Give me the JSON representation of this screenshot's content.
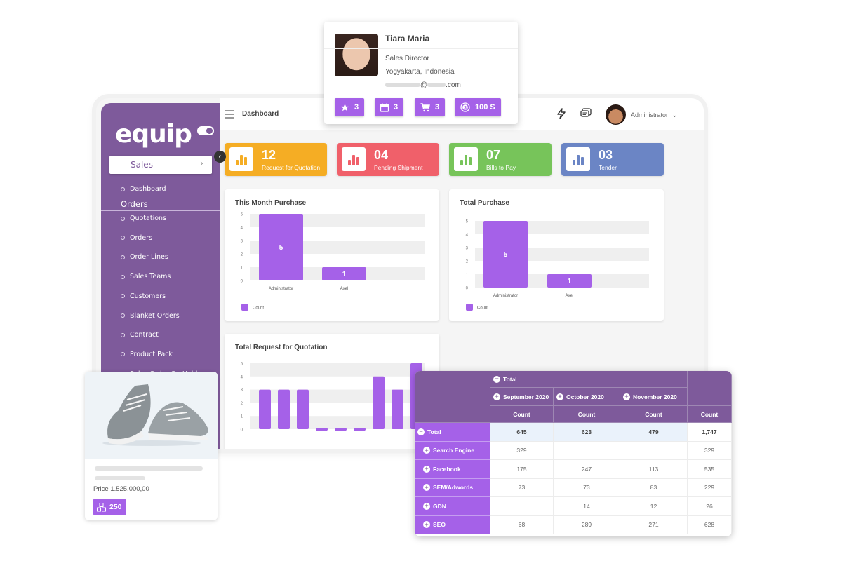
{
  "app": {
    "logo": "equip",
    "sidebar": {
      "active_module": "Sales",
      "items_top": [
        {
          "label": "Dashboard"
        }
      ],
      "section": "Orders",
      "items": [
        {
          "label": "Quotations"
        },
        {
          "label": "Orders"
        },
        {
          "label": "Order Lines"
        },
        {
          "label": "Sales Teams"
        },
        {
          "label": "Customers"
        },
        {
          "label": "Blanket Orders"
        },
        {
          "label": "Contract"
        },
        {
          "label": "Product Pack"
        },
        {
          "label": "Sales Order  On Hold"
        }
      ]
    },
    "topbar": {
      "title": "Dashboard",
      "icons": [
        "lightning-icon",
        "chat-icon"
      ],
      "user": "Administrator",
      "user_chevron": "⌄"
    },
    "stats": [
      {
        "value": "12",
        "label": "Request for Quotation",
        "color": "#f5ad24"
      },
      {
        "value": "04",
        "label": "Pending Shipment",
        "color": "#f0606a"
      },
      {
        "value": "07",
        "label": "Bills to Pay",
        "color": "#77c45a"
      },
      {
        "value": "03",
        "label": "Tender",
        "color": "#6b85c5"
      }
    ]
  },
  "profile": {
    "name": "Tiara Maria",
    "title": "Sales Director",
    "location": "Yogyakarta, Indonesia",
    "email_at": "@",
    "email_domain_suffix": ".com",
    "badges": [
      {
        "icon": "star-icon",
        "glyph": "★",
        "value": "3"
      },
      {
        "icon": "calendar-icon",
        "glyph": "▦",
        "value": "3"
      },
      {
        "icon": "cart-icon",
        "glyph": "🛒",
        "value": "3"
      },
      {
        "icon": "coin-icon",
        "glyph": "$",
        "value": "100 S"
      }
    ]
  },
  "product": {
    "price_label": "Price 1.525.000,00",
    "stock": "250"
  },
  "chart_data": [
    {
      "type": "bar",
      "title": "This Month Purchase",
      "categories": [
        "Administrator",
        "Axel"
      ],
      "values": [
        5,
        1
      ],
      "legend": [
        "Count"
      ],
      "legend_position": "bottom-left",
      "ylim": [
        0,
        5
      ],
      "yticks": [
        0,
        1,
        2,
        3,
        4,
        5
      ],
      "color": "#a561e8"
    },
    {
      "type": "bar",
      "title": "Total Purchase",
      "categories": [
        "Administrator",
        "Axel"
      ],
      "values": [
        5,
        1
      ],
      "legend": [
        "Count"
      ],
      "legend_position": "bottom-left",
      "ylim": [
        0,
        5
      ],
      "yticks": [
        0,
        1,
        2,
        3,
        4,
        5
      ],
      "color": "#a561e8"
    },
    {
      "type": "bar",
      "title": "Total Request for Quotation",
      "categories": [
        "",
        "",
        "",
        "",
        "",
        "",
        "",
        "",
        ""
      ],
      "values": [
        3,
        3,
        3,
        0.1,
        0.1,
        0.1,
        4,
        3,
        5
      ],
      "ylim": [
        0,
        5
      ],
      "yticks": [
        0,
        1,
        2,
        3,
        4,
        5
      ],
      "color": "#a561e8"
    }
  ],
  "pivot": {
    "top_header": "Total",
    "months": [
      "September 2020",
      "October 2020",
      "November 2020"
    ],
    "measure": "Count",
    "total_row": {
      "label": "Total",
      "values": [
        "645",
        "623",
        "479"
      ],
      "total": "1,747"
    },
    "rows": [
      {
        "label": "Search Engine",
        "values": [
          "329",
          "",
          ""
        ],
        "total": "329"
      },
      {
        "label": "Facebook",
        "values": [
          "175",
          "247",
          "113"
        ],
        "total": "535"
      },
      {
        "label": "SEM/Adwords",
        "values": [
          "73",
          "73",
          "83"
        ],
        "total": "229"
      },
      {
        "label": "GDN",
        "values": [
          "",
          "14",
          "12"
        ],
        "total": "26"
      },
      {
        "label": "SEO",
        "values": [
          "68",
          "289",
          "271"
        ],
        "total": "628"
      }
    ]
  }
}
